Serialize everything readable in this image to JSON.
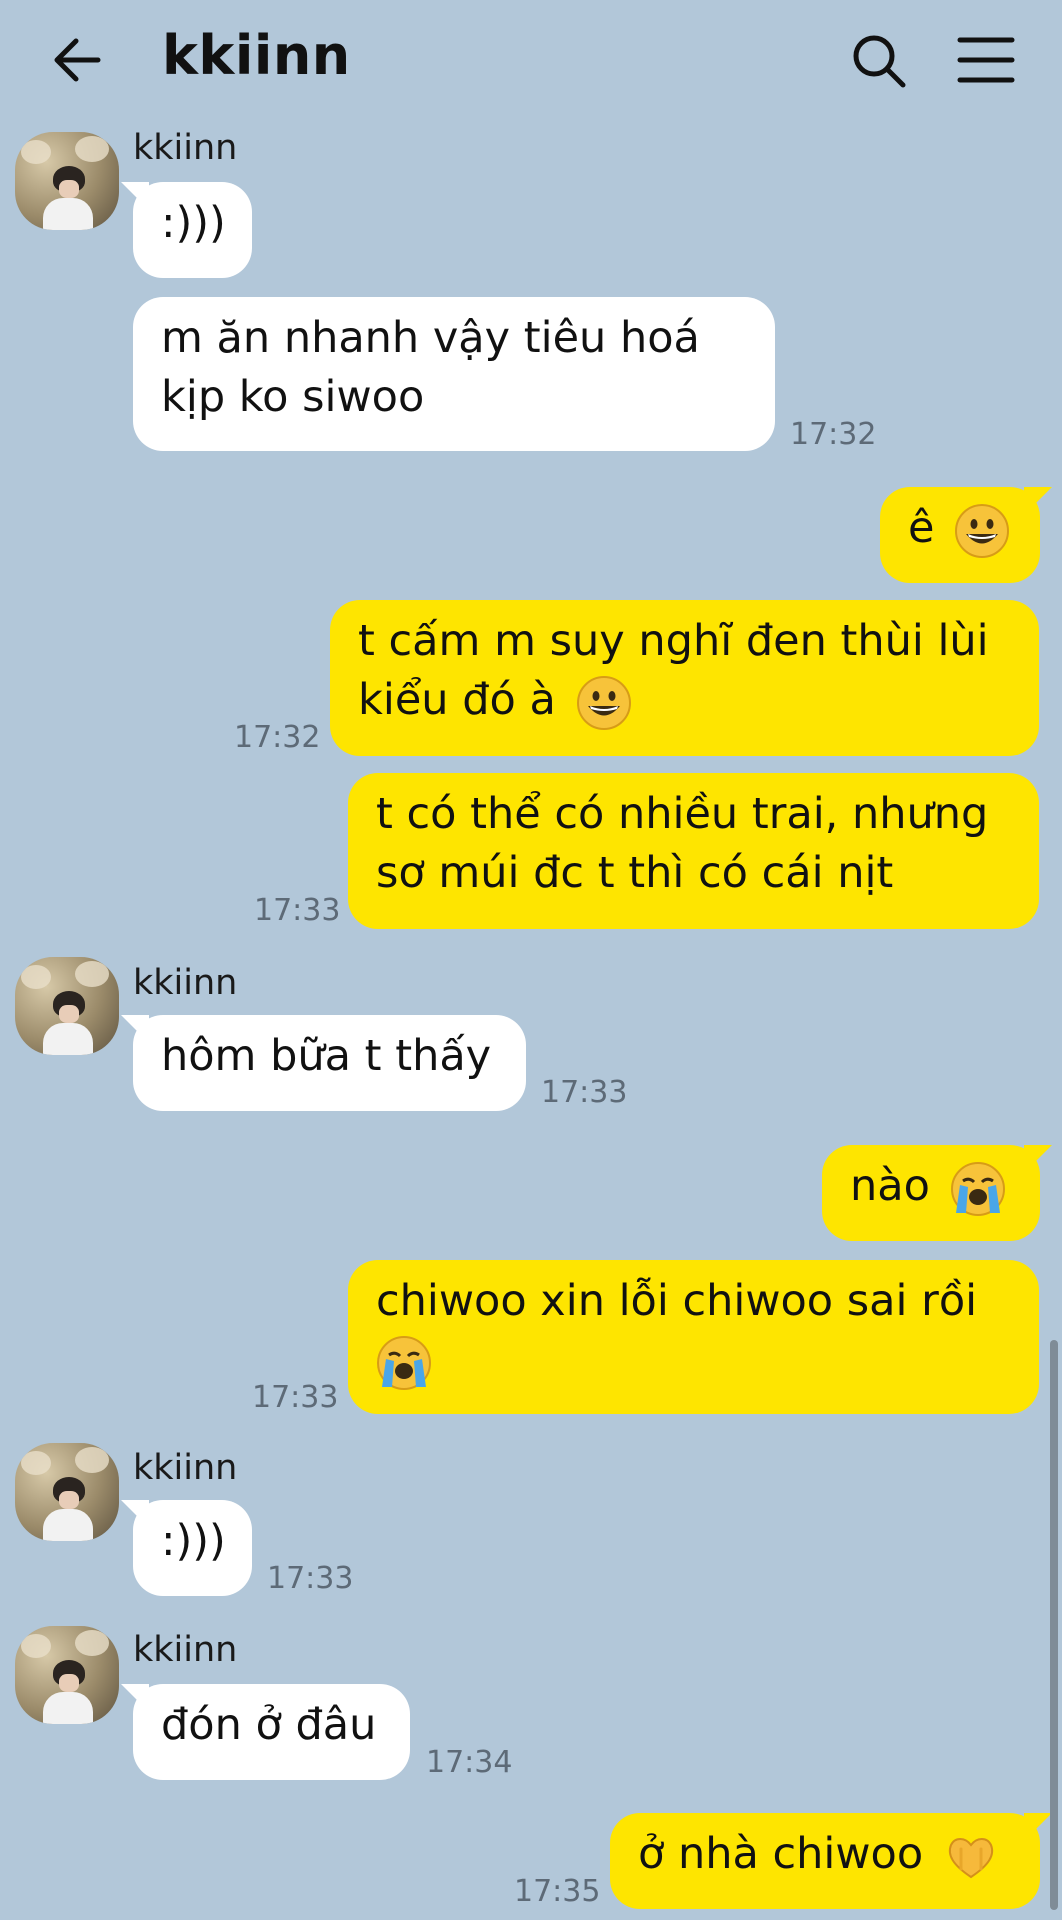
{
  "header": {
    "title": "kkiinn",
    "back_icon": "arrow-left-icon",
    "search_icon": "search-icon",
    "menu_icon": "hamburger-menu-icon"
  },
  "colors": {
    "background": "#b2c7d9",
    "incoming_bubble": "#ffffff",
    "outgoing_bubble": "#fee500",
    "timestamp": "#5d6a77"
  },
  "messages": [
    {
      "direction": "in",
      "sender": "kkiinn",
      "text": ":)))",
      "time": ""
    },
    {
      "direction": "in",
      "sender": "",
      "line1": "m ăn nhanh vậy tiêu hoá",
      "line2": "kịp ko siwoo",
      "time": "17:32"
    },
    {
      "direction": "out",
      "text": "ê",
      "emoji": "grinning-face-icon",
      "time": ""
    },
    {
      "direction": "out",
      "line1": "t cấm m suy nghĩ đen thùi lùi",
      "line2": "kiểu đó à",
      "emoji": "grinning-face-icon",
      "time": "17:32"
    },
    {
      "direction": "out",
      "line1": "t có thể có nhiều trai, nhưng",
      "line2": "sơ múi đc t thì có cái nịt",
      "time": "17:33"
    },
    {
      "direction": "in",
      "sender": "kkiinn",
      "text": "hôm bữa t thấy",
      "time": "17:33"
    },
    {
      "direction": "out",
      "text": "nào",
      "emoji": "loudly-crying-face-icon",
      "time": ""
    },
    {
      "direction": "out",
      "line1": "chiwoo xin lỗi chiwoo sai rồi",
      "emoji": "loudly-crying-face-icon",
      "time": "17:33"
    },
    {
      "direction": "in",
      "sender": "kkiinn",
      "text": ":)))",
      "time": "17:33"
    },
    {
      "direction": "in",
      "sender": "kkiinn",
      "text": "đón ở đâu",
      "time": "17:34"
    },
    {
      "direction": "out",
      "text": "ở nhà chiwoo",
      "emoji": "heart-hands-icon",
      "time": "17:35"
    }
  ]
}
